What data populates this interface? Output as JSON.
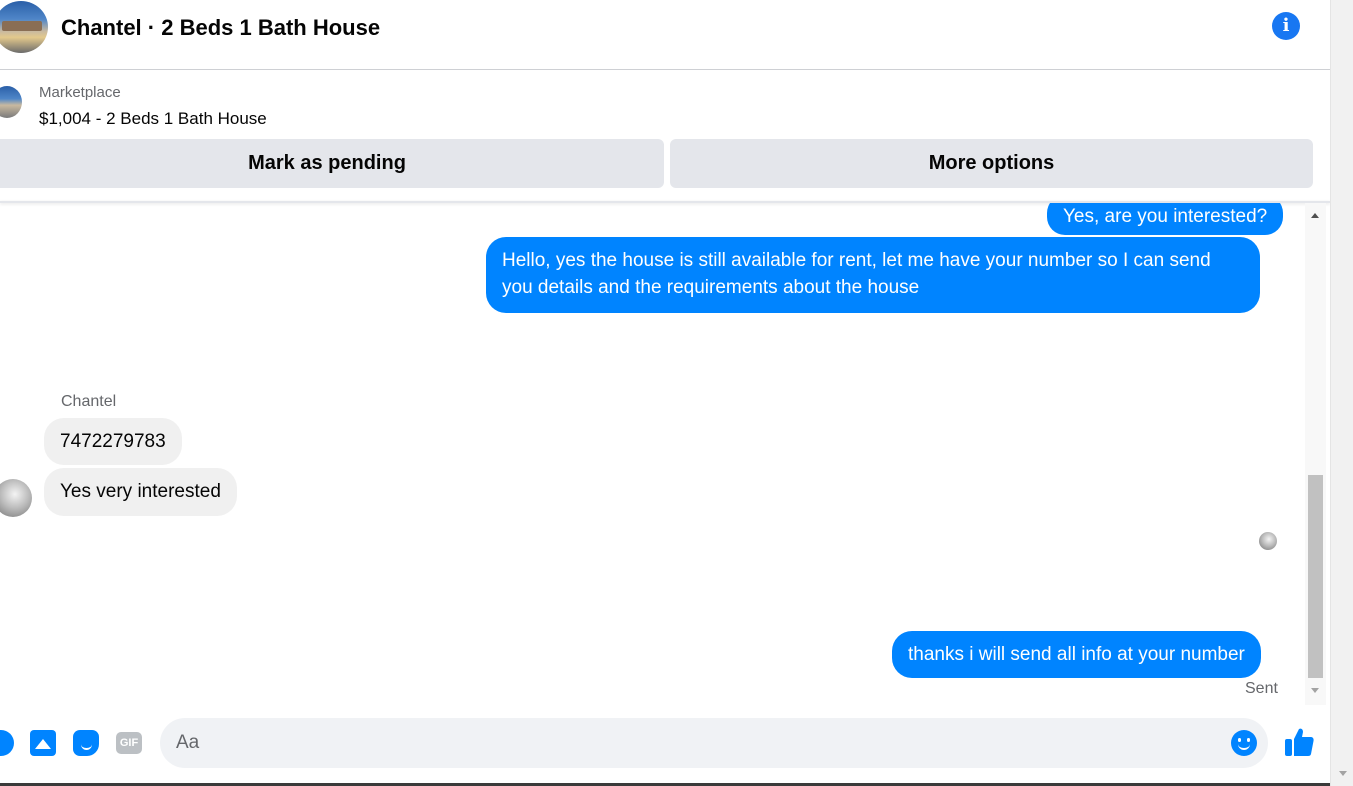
{
  "header": {
    "title": "Chantel · 2 Beds 1 Bath House"
  },
  "marketplace": {
    "label": "Marketplace",
    "listing": "$1,004 - 2 Beds 1 Bath House",
    "mark_pending": "Mark as pending",
    "more_options": "More options"
  },
  "messages": {
    "m1": "Yes, are you interested?",
    "m2": "Hello, yes the house is still available for rent, let me have your number so I can send you details and the requirements about the house",
    "sender": "Chantel",
    "m3": "7472279783",
    "m4": "Yes very interested",
    "m5": "thanks i will send all info at your number",
    "status": "Sent"
  },
  "composer": {
    "placeholder": "Aa",
    "gif_label": "GIF"
  },
  "colors": {
    "accent": "#0084ff",
    "incoming_bubble": "#f0f0f0"
  },
  "icons": [
    "info-icon",
    "add-icon",
    "photo-icon",
    "sticker-icon",
    "gif-icon",
    "emoji-icon",
    "thumbs-up-icon"
  ]
}
